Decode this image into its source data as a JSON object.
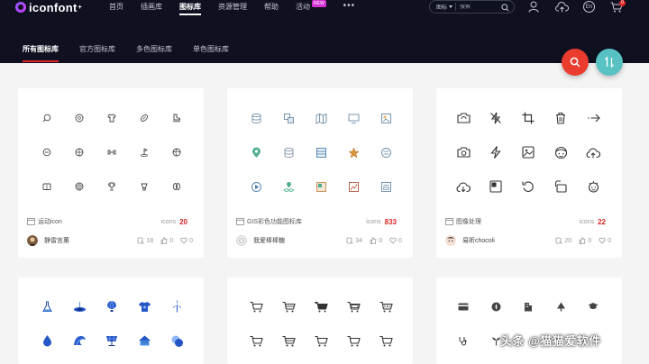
{
  "brand": {
    "name": "iconfont",
    "mark": "+"
  },
  "nav": [
    {
      "label": "首页"
    },
    {
      "label": "插画库"
    },
    {
      "label": "图标库",
      "active": true
    },
    {
      "label": "资源管理"
    },
    {
      "label": "帮助"
    },
    {
      "label": "活动",
      "badge": "NEW"
    }
  ],
  "nav_more": "•••",
  "search": {
    "category": "图标",
    "placeholder": "搜索"
  },
  "language": "En",
  "cart_count": "0",
  "subtabs": [
    {
      "label": "所有图标库",
      "active": true
    },
    {
      "label": "官方图标库"
    },
    {
      "label": "多色图标库"
    },
    {
      "label": "单色图标库"
    }
  ],
  "colors": {
    "topbar": "#0f1020",
    "accent_red": "#e02424",
    "fab_search": "#e93c2f",
    "fab_sort": "#57c1c4"
  },
  "cards": [
    {
      "title": "运动icon",
      "count_label": "icons",
      "count": "20",
      "author": "静雷言菓",
      "favorites": "18",
      "likes": "0",
      "hearts": "0"
    },
    {
      "title": "GIS彩色功能图标库",
      "count_label": "icons",
      "count": "833",
      "author": "我爱棒棒糖",
      "favorites": "34",
      "likes": "0",
      "hearts": "0"
    },
    {
      "title": "图像处理",
      "count_label": "icons",
      "count": "22",
      "author": "易昕chocoli",
      "favorites": "20",
      "likes": "0",
      "hearts": "0"
    }
  ],
  "watermark": "头条 @猫猫爱软件"
}
